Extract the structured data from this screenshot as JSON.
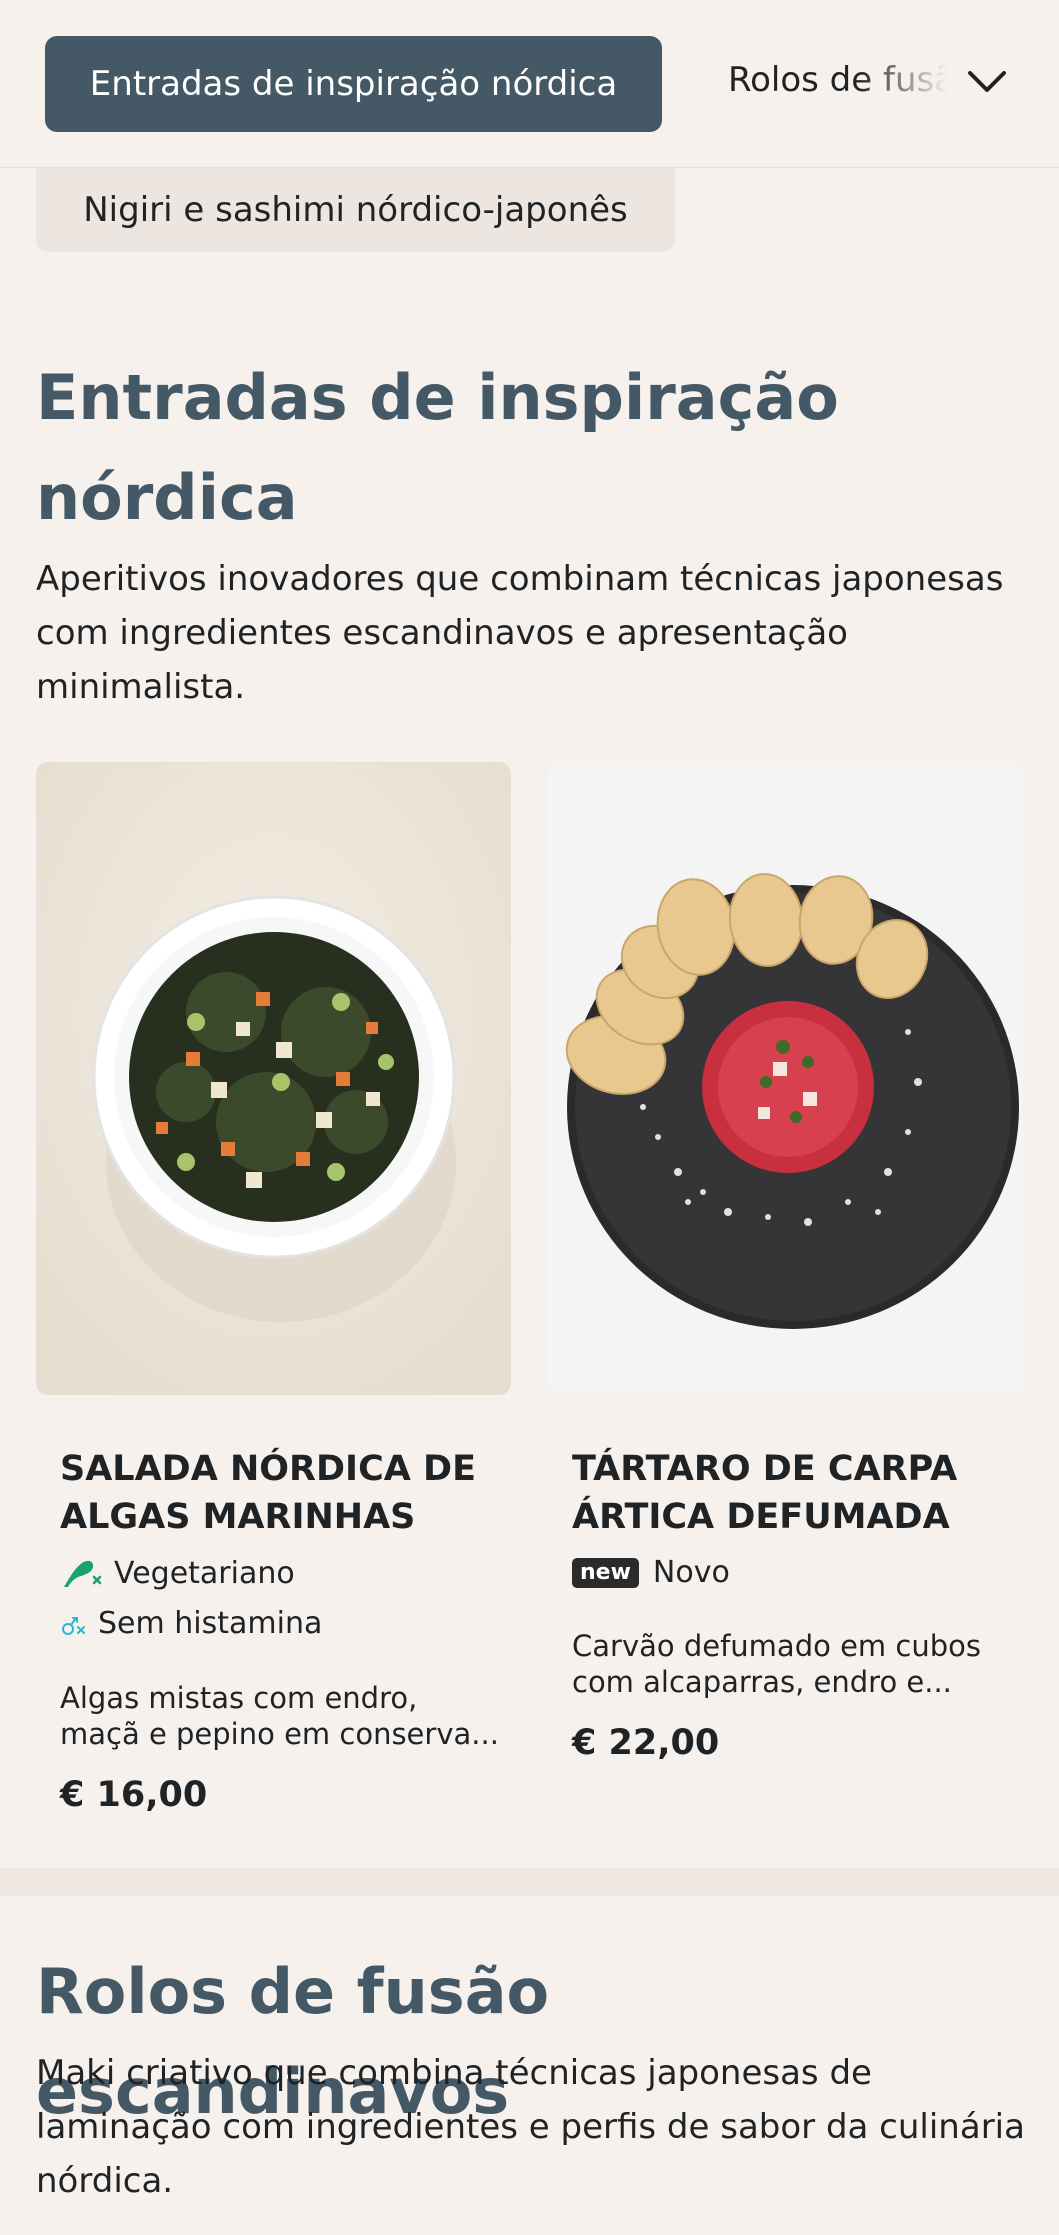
{
  "nav": {
    "active_category": "Entradas de inspiração nórdica",
    "next_category": "Rolos de fusão escandinavos",
    "open_category": "Nigiri e sashimi nórdico-japonês"
  },
  "sections": [
    {
      "title": "Entradas de inspiração nórdica",
      "description": "Aperitivos inovadores que combinam técnicas japonesas com ingredientes escandinavos e apresentação minimalista."
    },
    {
      "title": "Rolos de fusão escandinavos",
      "description": "Maki criativo que combina técnicas japonesas de laminação com ingredientes e perfis de sabor da culinária nórdica."
    }
  ],
  "items": [
    {
      "name": "SALADA NÓRDICA DE ALGAS MARINHAS",
      "tags": [
        {
          "icon": "vegetarian-icon",
          "label": "Vegetariano"
        },
        {
          "icon": "histamine-free-icon",
          "label": "Sem histamina"
        }
      ],
      "description": "Algas mistas com endro, maçã e pepino em conserva...",
      "price": "€ 16,00"
    },
    {
      "name": "TÁRTARO DE CARPA ÁRTICA DEFUMADA",
      "badge": "new",
      "tags": [
        {
          "icon": "new-badge",
          "label": "Novo"
        }
      ],
      "description": "Carvão defumado em cubos com alcaparras, endro e...",
      "price": "€ 22,00"
    }
  ],
  "colors": {
    "accent": "#445866",
    "background": "#f6f1ed",
    "vegetarian_green": "#1aa36b",
    "histamine_cyan": "#29b6d1"
  }
}
